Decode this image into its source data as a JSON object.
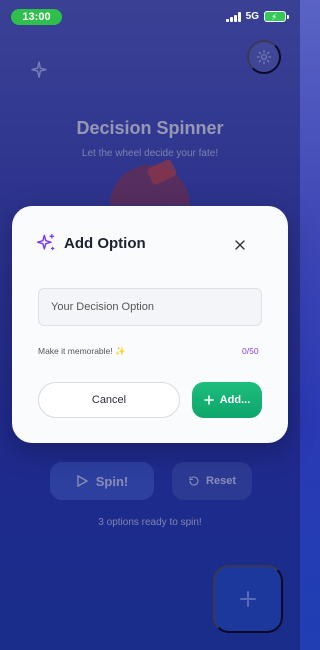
{
  "status_bar": {
    "time": "13:00",
    "network": "5G"
  },
  "background_app": {
    "title": "Decision Spinner",
    "subtitle": "Let the wheel decide your fate!",
    "spin_label": "Spin!",
    "reset_label": "Reset",
    "status_text": "3 options ready to spin!"
  },
  "modal": {
    "title": "Add Option",
    "input": {
      "placeholder": "Your Decision Option",
      "value": ""
    },
    "hint": "Make it memorable! ✨",
    "char_count": "0/50",
    "cancel_label": "Cancel",
    "add_label": "Add..."
  },
  "colors": {
    "accent_purple": "#7c3aed",
    "add_green": "#12b074",
    "counter_purple": "#8b3fd6",
    "time_pill": "#2fbf4c"
  },
  "icons": {
    "title_icon": "sparkles-icon",
    "close_icon": "close-icon",
    "add_icon": "plus-icon"
  }
}
